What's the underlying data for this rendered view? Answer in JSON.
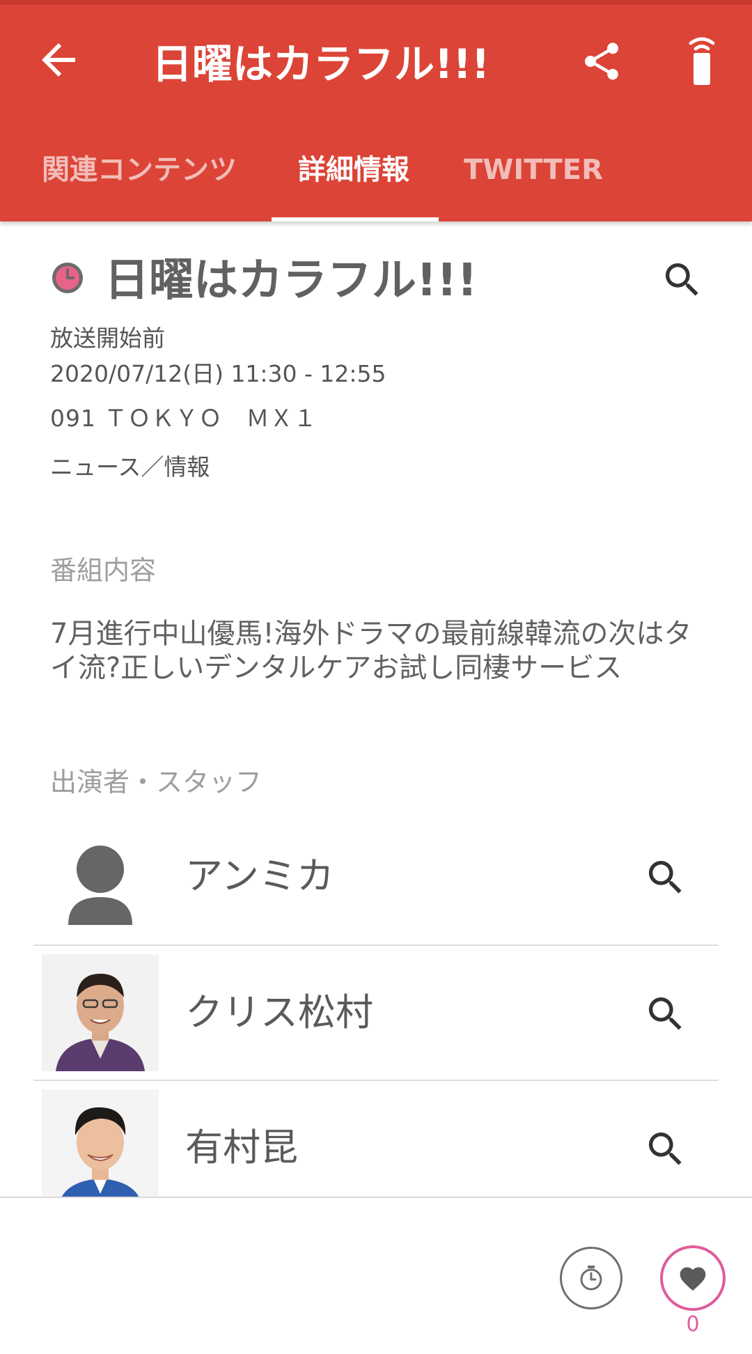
{
  "app_bar": {
    "title": "日曜はカラフル!!!",
    "background": "#db4437",
    "icons": {
      "back": "arrow-back-icon",
      "share": "share-icon",
      "remote": "remote-control-icon"
    }
  },
  "tabs": [
    {
      "label": "関連コンテンツ",
      "selected": false
    },
    {
      "label": "詳細情報",
      "selected": true
    },
    {
      "label": "TWITTER",
      "selected": false
    }
  ],
  "program": {
    "title": "日曜はカラフル!!!",
    "status": "放送開始前",
    "datetime": "2020/07/12(日) 11:30 - 12:55",
    "channel": "091 ＴＯＫＹＯ　ＭＸ１",
    "genre": "ニュース／情報"
  },
  "sections": {
    "content_label": "番組内容",
    "content_body": "7月進行中山優馬!海外ドラマの最前線韓流の次はタイ流?正しいデンタルケアお試し同棲サービス",
    "cast_label": "出演者・スタッフ"
  },
  "cast": [
    {
      "name": "アンミカ",
      "photo": "placeholder-avatar"
    },
    {
      "name": "クリス松村",
      "photo": "person-photo"
    },
    {
      "name": "有村昆",
      "photo": "person-photo"
    }
  ],
  "bottom_bar": {
    "favorite_count": "0",
    "accent": "#e05c9c",
    "icons": {
      "timer": "timer-icon",
      "favorite": "heart-icon"
    }
  }
}
